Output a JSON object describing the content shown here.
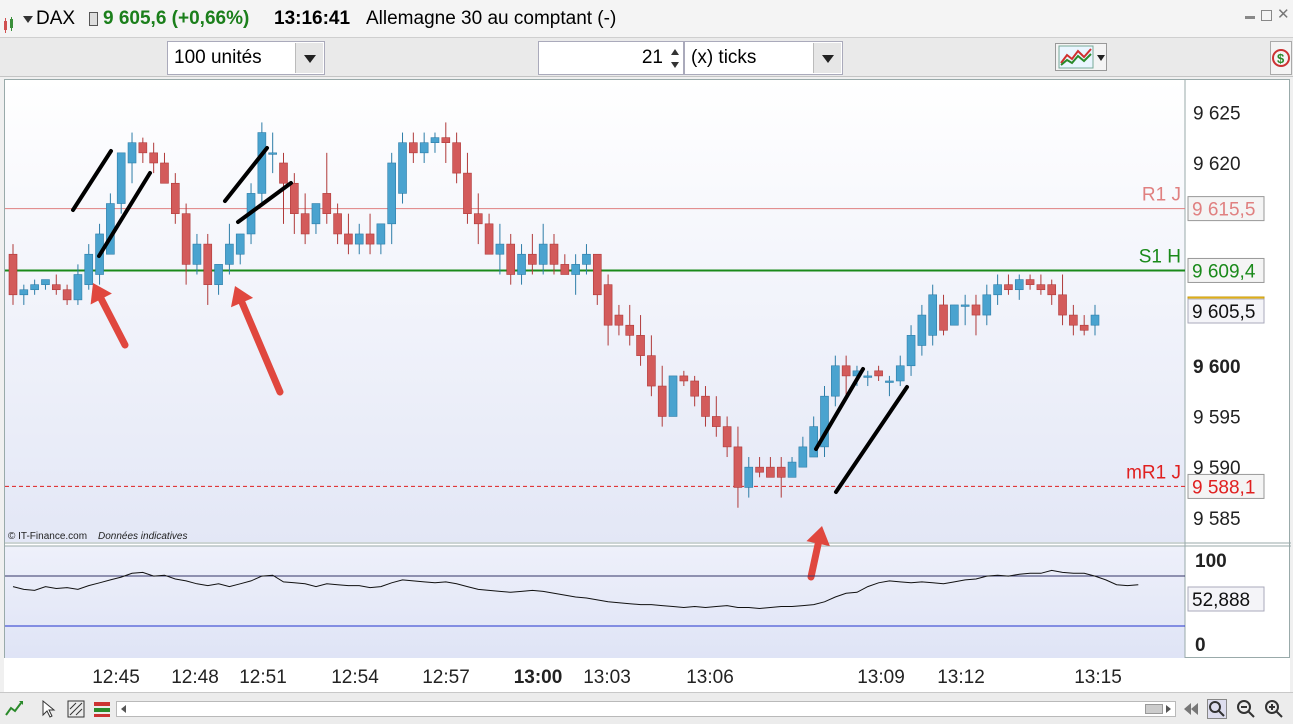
{
  "header": {
    "symbol": "DAX",
    "price_change": "9 605,6 (+0,66%)",
    "time": "13:16:41",
    "description": "Allemagne 30 au comptant (-)"
  },
  "toolbar": {
    "units_select": "100 unités",
    "tick_count": "21",
    "tick_select": "(x) ticks"
  },
  "chart": {
    "y_ticks": [
      "9 625",
      "9 620",
      "9 615,5",
      "9 609,4",
      "9 605,6",
      "9 605,5",
      "9 600",
      "9 595",
      "9 590",
      "9 588,1",
      "9 585"
    ],
    "levels": [
      {
        "name": "R1 J",
        "value": "9 615,5",
        "color": "#e08080"
      },
      {
        "name": "S1 H",
        "value": "9 609,4",
        "color": "#1a8a1a"
      },
      {
        "name": "mR1 J",
        "value": "9 588,1",
        "color": "#e02020"
      }
    ],
    "current_price": "9 605,6",
    "last_close": "9 605,5",
    "copyright": "© IT-Finance.com",
    "disclaimer": "Données indicatives",
    "x_ticks": [
      "12:45",
      "12:48",
      "12:51",
      "12:54",
      "12:57",
      "13:00",
      "13:03",
      "13:06",
      "13:09",
      "13:12",
      "13:15"
    ],
    "indicator": {
      "top_label": "100",
      "bottom_label": "0",
      "value": "52,888"
    }
  },
  "chart_data": {
    "type": "candlestick",
    "ylim": [
      9584,
      9627
    ],
    "candles": [
      [
        9611,
        9612,
        9606,
        9607
      ],
      [
        9607,
        9608,
        9606,
        9607.5
      ],
      [
        9607.5,
        9608.5,
        9607,
        9608
      ],
      [
        9608,
        9608.5,
        9607.5,
        9608.5
      ],
      [
        9608,
        9609,
        9607,
        9607.5
      ],
      [
        9607.5,
        9608,
        9606,
        9606.5
      ],
      [
        9606.5,
        9610,
        9606,
        9609
      ],
      [
        9608,
        9612,
        9607.5,
        9611
      ],
      [
        9609,
        9614,
        9608,
        9613
      ],
      [
        9611,
        9617,
        9611,
        9616
      ],
      [
        9616,
        9621,
        9615,
        9621
      ],
      [
        9620,
        9623,
        9618,
        9622
      ],
      [
        9622,
        9622.5,
        9620,
        9621
      ],
      [
        9621,
        9622,
        9619,
        9620
      ],
      [
        9620,
        9621,
        9618,
        9618
      ],
      [
        9618,
        9619,
        9614,
        9615
      ],
      [
        9615,
        9616,
        9608,
        9610
      ],
      [
        9610,
        9613,
        9609,
        9612
      ],
      [
        9612,
        9613,
        9606,
        9608
      ],
      [
        9608,
        9610,
        9607,
        9610
      ],
      [
        9610,
        9614,
        9609,
        9612
      ],
      [
        9611,
        9613,
        9610,
        9613
      ],
      [
        9613,
        9618,
        9612,
        9617
      ],
      [
        9617,
        9624,
        9616,
        9623
      ],
      [
        9621,
        9623,
        9619,
        9621
      ],
      [
        9620,
        9621,
        9614,
        9618
      ],
      [
        9618,
        9619,
        9613,
        9615
      ],
      [
        9615,
        9617,
        9612,
        9613
      ],
      [
        9614,
        9616,
        9613,
        9616
      ],
      [
        9617,
        9621,
        9614,
        9615
      ],
      [
        9615,
        9616,
        9612,
        9613
      ],
      [
        9613,
        9615,
        9611,
        9612
      ],
      [
        9612,
        9614,
        9611,
        9613
      ],
      [
        9613,
        9615,
        9611,
        9612
      ],
      [
        9612,
        9614,
        9611,
        9614
      ],
      [
        9614,
        9621,
        9612,
        9620
      ],
      [
        9617,
        9623,
        9616,
        9622
      ],
      [
        9622,
        9623,
        9620,
        9621
      ],
      [
        9621,
        9623,
        9620,
        9622
      ],
      [
        9622,
        9623,
        9621,
        9622.5
      ],
      [
        9622.5,
        9624,
        9620,
        9622
      ],
      [
        9622,
        9623,
        9618,
        9619
      ],
      [
        9619,
        9621,
        9614,
        9615
      ],
      [
        9615,
        9617,
        9612,
        9614
      ],
      [
        9614,
        9615,
        9611,
        9611
      ],
      [
        9611,
        9614,
        9609,
        9612
      ],
      [
        9612,
        9613,
        9608,
        9609
      ],
      [
        9609,
        9612,
        9608,
        9611
      ],
      [
        9611,
        9613,
        9609,
        9610
      ],
      [
        9610,
        9614,
        9609,
        9612
      ],
      [
        9612,
        9613,
        9609,
        9610
      ],
      [
        9610,
        9611,
        9609,
        9609
      ],
      [
        9609,
        9611,
        9607,
        9610
      ],
      [
        9610,
        9612,
        9609,
        9611
      ],
      [
        9611,
        9611,
        9606,
        9607
      ],
      [
        9608,
        9609,
        9602,
        9604
      ],
      [
        9605,
        9606,
        9603,
        9604
      ],
      [
        9604,
        9606,
        9602,
        9603
      ],
      [
        9603,
        9605,
        9600,
        9601
      ],
      [
        9601,
        9603,
        9597,
        9598
      ],
      [
        9598,
        9600,
        9594,
        9595
      ],
      [
        9595,
        9599,
        9595,
        9599
      ],
      [
        9599,
        9599.5,
        9598,
        9598.5
      ],
      [
        9598.5,
        9599,
        9596,
        9597
      ],
      [
        9597,
        9598,
        9594,
        9595
      ],
      [
        9595,
        9597,
        9593,
        9594
      ],
      [
        9594,
        9595,
        9591,
        9592
      ],
      [
        9592,
        9594,
        9586,
        9588
      ],
      [
        9588,
        9591,
        9587,
        9590
      ],
      [
        9590,
        9591,
        9589,
        9589.5
      ],
      [
        9590,
        9591,
        9589,
        9589
      ],
      [
        9590,
        9591,
        9587,
        9589
      ],
      [
        9589,
        9591,
        9589,
        9590.5
      ],
      [
        9590,
        9593,
        9590,
        9592
      ],
      [
        9591,
        9595,
        9591,
        9594
      ],
      [
        9592,
        9598,
        9591,
        9597
      ],
      [
        9597,
        9601,
        9596,
        9600
      ],
      [
        9600,
        9601,
        9597,
        9599
      ],
      [
        9599,
        9600,
        9598,
        9599.5
      ],
      [
        9599,
        9599.5,
        9598,
        9599
      ],
      [
        9599.5,
        9600,
        9598.5,
        9599
      ],
      [
        9598.5,
        9599,
        9597,
        9598.5
      ],
      [
        9598.5,
        9601,
        9598,
        9600
      ],
      [
        9600,
        9604,
        9599,
        9603
      ],
      [
        9602,
        9606,
        9601,
        9605
      ],
      [
        9603,
        9608,
        9602,
        9607
      ],
      [
        9606,
        9607,
        9603,
        9603.5
      ],
      [
        9604,
        9606,
        9605,
        9606
      ],
      [
        9606,
        9607,
        9604,
        9606
      ],
      [
        9606,
        9607,
        9603,
        9605
      ],
      [
        9605,
        9608,
        9604,
        9607
      ],
      [
        9607,
        9609,
        9606,
        9608
      ],
      [
        9608,
        9609,
        9607,
        9607.5
      ],
      [
        9607.5,
        9609,
        9606.5,
        9608.5
      ],
      [
        9608.5,
        9609,
        9607.5,
        9608
      ],
      [
        9608,
        9609,
        9607,
        9607.5
      ],
      [
        9608,
        9608.5,
        9606,
        9607
      ],
      [
        9607,
        9609,
        9604,
        9605
      ],
      [
        9605,
        9606,
        9603,
        9604
      ],
      [
        9604,
        9605,
        9603,
        9603.5
      ],
      [
        9604,
        9606,
        9603,
        9605
      ]
    ],
    "indicator_values": [
      52,
      49,
      48,
      52,
      50,
      51,
      49,
      53,
      56,
      59,
      62,
      66,
      67,
      63,
      64,
      60,
      58,
      55,
      53,
      55,
      52,
      55,
      58,
      63,
      64,
      57,
      56,
      55,
      52,
      55,
      54,
      53,
      53,
      51,
      52,
      56,
      59,
      58,
      57,
      56,
      57,
      55,
      52,
      49,
      48,
      47,
      46,
      47,
      48,
      47,
      45,
      43,
      41,
      40,
      38,
      36,
      35,
      34,
      33,
      33,
      32,
      31,
      30,
      31,
      30,
      31,
      32,
      30,
      30,
      29,
      30,
      31,
      31,
      32,
      33,
      36,
      41,
      45,
      46,
      52,
      56,
      58,
      57,
      56,
      57,
      56,
      55,
      57,
      59,
      60,
      63,
      64,
      63,
      65,
      66,
      66,
      69,
      67,
      66,
      66,
      63,
      59,
      54,
      53,
      54
    ]
  }
}
